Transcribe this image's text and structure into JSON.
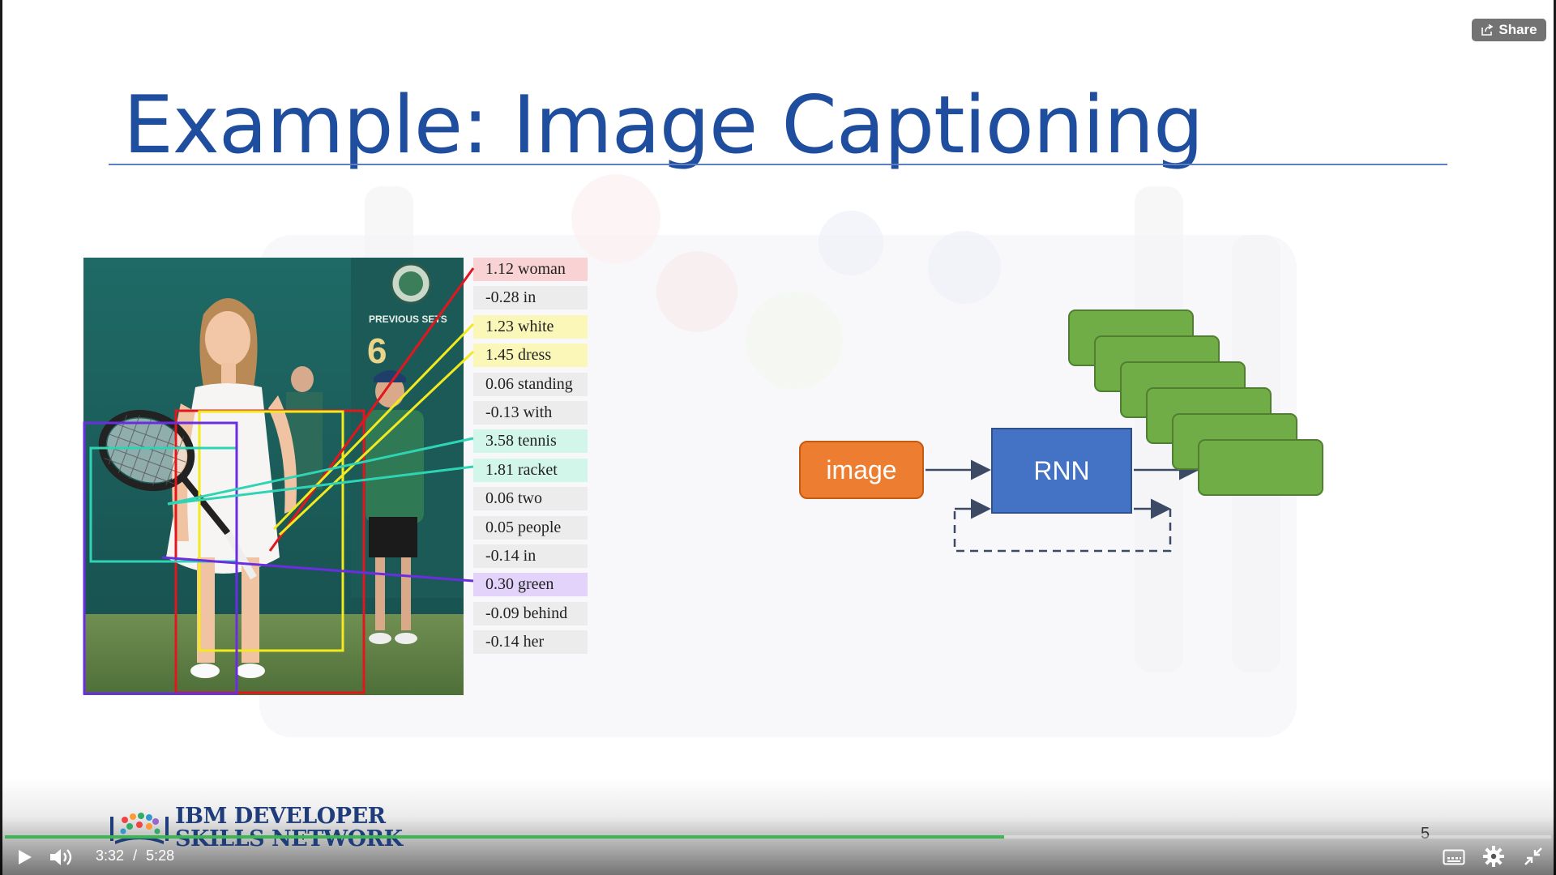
{
  "player": {
    "share_label": "Share",
    "current_time": "3:32",
    "time_separator": "/",
    "duration": "5:28",
    "progress": 0.646,
    "slide_number": "5"
  },
  "slide": {
    "title": "Example: Image Captioning"
  },
  "photo": {
    "scoreboard_label": "PREVIOUS SETS",
    "scoreboard_digit": "6"
  },
  "words": [
    {
      "label": "1.12 woman",
      "color": "#f9d3d3"
    },
    {
      "label": "-0.28 in",
      "color": "#ececec"
    },
    {
      "label": "1.23 white",
      "color": "#fbf7b9"
    },
    {
      "label": "1.45 dress",
      "color": "#fbf7b9"
    },
    {
      "label": "0.06 standing",
      "color": "#ececec"
    },
    {
      "label": "-0.13 with",
      "color": "#ececec"
    },
    {
      "label": "3.58 tennis",
      "color": "#d3f6ea"
    },
    {
      "label": "1.81 racket",
      "color": "#d3f6ea"
    },
    {
      "label": "0.06 two",
      "color": "#ececec"
    },
    {
      "label": "0.05 people",
      "color": "#ececec"
    },
    {
      "label": "-0.14 in",
      "color": "#ececec"
    },
    {
      "label": "0.30 green",
      "color": "#e3d3fb"
    },
    {
      "label": "-0.09 behind",
      "color": "#ececec"
    },
    {
      "label": "-0.14 her",
      "color": "#ececec"
    }
  ],
  "diagram": {
    "input_label": "image",
    "rnn_label": "RNN"
  },
  "brand": {
    "line1": "IBM DEVELOPER",
    "line2": "SKILLS NETWORK"
  },
  "colors": {
    "title": "#1f4e9e",
    "progress": "#3db554",
    "box_red": "#e3161d",
    "box_yellow": "#f2ea1f",
    "box_cyan": "#2fd4b4",
    "box_purple": "#6a2ee0"
  }
}
